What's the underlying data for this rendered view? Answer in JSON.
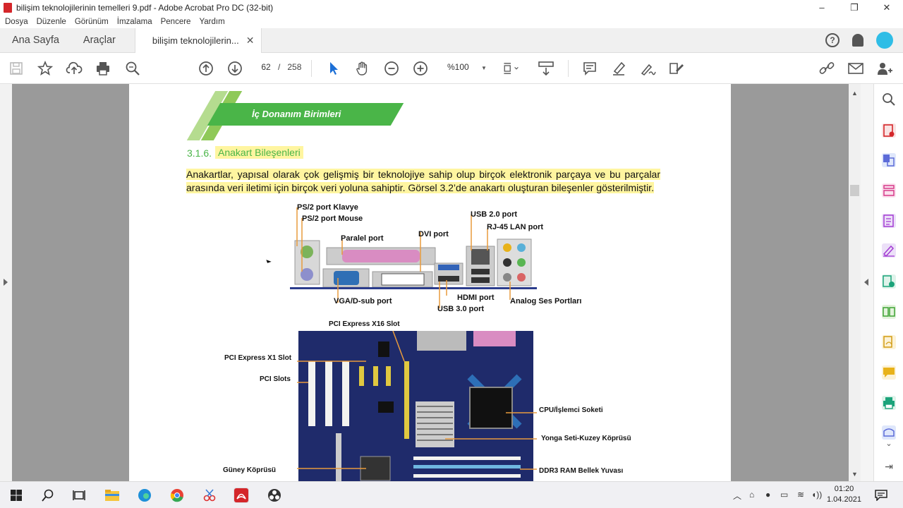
{
  "window": {
    "title": "bilişim teknolojilerinin temelleri 9.pdf - Adobe Acrobat Pro DC (32-bit)",
    "controls": [
      "–",
      "❐",
      "✕"
    ]
  },
  "menu": [
    "Dosya",
    "Düzenle",
    "Görünüm",
    "İmzalama",
    "Pencere",
    "Yardım"
  ],
  "tabs": {
    "home": "Ana Sayfa",
    "tools": "Araçlar",
    "document": "bilişim teknolojilerin...",
    "close": "✕",
    "help": "?"
  },
  "toolbar": {
    "page_current": "62",
    "page_sep": "/",
    "page_total": "258",
    "zoom": "%100"
  },
  "document": {
    "banner": "İç Donanım Birimleri",
    "section_number": "3.1.6.",
    "section_title": "Anakart Bileşenleri",
    "paragraph": "Anakartlar, yapısal olarak çok gelişmiş bir teknolojiye sahip olup birçok elektronik parçaya ve bu parçalar arasında veri iletimi için birçok veri yoluna sahiptir. Görsel 3.2’de anakartı oluşturan bileşenler gösterilmiştir.",
    "ports_labels": {
      "ps2_keyboard": "PS/2 port Klavye",
      "ps2_mouse": "PS/2 port Mouse",
      "parallel": "Paralel port",
      "dvi": "DVI port",
      "usb2": "USB 2.0 port",
      "rj45": "RJ-45 LAN port",
      "vga": "VGA/D-sub port",
      "hdmi": "HDMI port",
      "usb3": "USB 3.0 port",
      "audio": "Analog Ses Portları"
    },
    "board_labels": {
      "pcie16": "PCI Express X16 Slot",
      "pcie1": "PCI Express X1 Slot",
      "pci": "PCI Slots",
      "cpu": "CPU/İşlemci Soketi",
      "northbridge": "Yonga Seti-Kuzey Köprüsü",
      "southbridge": "Güney Köprüsü",
      "ram": "DDR3 RAM  Bellek Yuvası"
    }
  },
  "taskbar": {
    "time": "01:20",
    "date": "1.04.2021"
  },
  "colors": {
    "accent_green": "#4ab548",
    "highlight": "#fff5a0",
    "board_blue": "#1f2b6b",
    "acrobat_red": "#d4262a"
  }
}
